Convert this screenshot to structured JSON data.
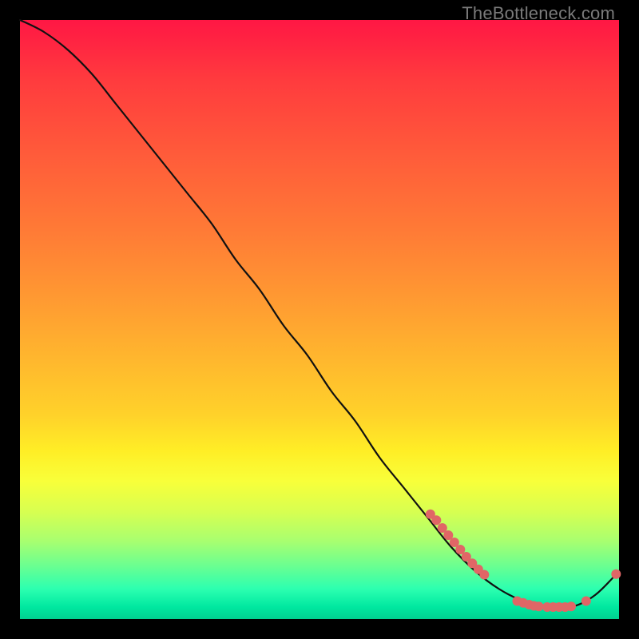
{
  "watermark": "TheBottleneck.com",
  "colors": {
    "curve": "#111111",
    "dot": "#e06666",
    "gradient_top": "#ff1744",
    "gradient_mid": "#ffee26",
    "gradient_bottom": "#00d090",
    "frame": "#000000"
  },
  "chart_data": {
    "type": "line",
    "title": "",
    "xlabel": "",
    "ylabel": "",
    "xlim": [
      0,
      100
    ],
    "ylim": [
      0,
      100
    ],
    "grid": false,
    "legend": false,
    "series": [
      {
        "name": "bottleneck-curve",
        "x": [
          0,
          4,
          8,
          12,
          16,
          20,
          24,
          28,
          32,
          36,
          40,
          44,
          48,
          52,
          56,
          60,
          64,
          68,
          72,
          76,
          80,
          84,
          88,
          92,
          96,
          100
        ],
        "values": [
          100,
          98,
          95,
          91,
          86,
          81,
          76,
          71,
          66,
          60,
          55,
          49,
          44,
          38,
          33,
          27,
          22,
          17,
          12,
          8,
          5,
          3,
          2,
          2,
          4,
          8
        ]
      }
    ],
    "points": [
      {
        "name": "cluster-point",
        "x": 68.5,
        "y": 17.5
      },
      {
        "name": "cluster-point",
        "x": 69.5,
        "y": 16.5
      },
      {
        "name": "cluster-point",
        "x": 70.5,
        "y": 15.2
      },
      {
        "name": "cluster-point",
        "x": 71.5,
        "y": 14.0
      },
      {
        "name": "cluster-point",
        "x": 72.5,
        "y": 12.8
      },
      {
        "name": "cluster-point",
        "x": 73.5,
        "y": 11.6
      },
      {
        "name": "cluster-point",
        "x": 74.5,
        "y": 10.4
      },
      {
        "name": "cluster-point",
        "x": 75.5,
        "y": 9.3
      },
      {
        "name": "cluster-point",
        "x": 76.5,
        "y": 8.3
      },
      {
        "name": "cluster-point",
        "x": 77.5,
        "y": 7.4
      },
      {
        "name": "cluster-point",
        "x": 83.0,
        "y": 3.0
      },
      {
        "name": "cluster-point",
        "x": 84.0,
        "y": 2.7
      },
      {
        "name": "cluster-point",
        "x": 85.0,
        "y": 2.4
      },
      {
        "name": "cluster-point",
        "x": 85.8,
        "y": 2.2
      },
      {
        "name": "cluster-point",
        "x": 86.6,
        "y": 2.1
      },
      {
        "name": "cluster-point",
        "x": 88.0,
        "y": 2.0
      },
      {
        "name": "cluster-point",
        "x": 89.0,
        "y": 2.0
      },
      {
        "name": "cluster-point",
        "x": 90.0,
        "y": 2.0
      },
      {
        "name": "cluster-point",
        "x": 91.0,
        "y": 2.0
      },
      {
        "name": "cluster-point",
        "x": 92.0,
        "y": 2.1
      },
      {
        "name": "cluster-point",
        "x": 94.5,
        "y": 3.0
      },
      {
        "name": "cluster-point",
        "x": 99.5,
        "y": 7.5
      }
    ]
  }
}
